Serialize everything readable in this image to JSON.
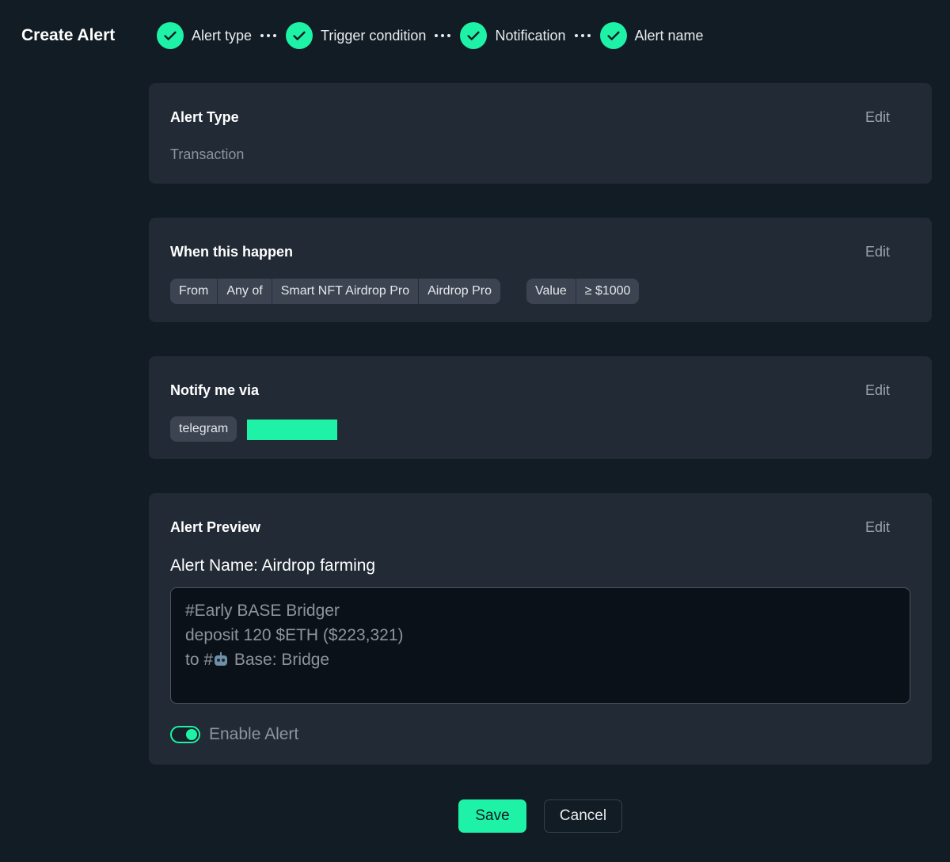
{
  "header": {
    "title": "Create Alert",
    "steps": [
      {
        "label": "Alert type",
        "icon": "check-circle-icon"
      },
      {
        "label": "Trigger condition",
        "icon": "check-circle-icon"
      },
      {
        "label": "Notification",
        "icon": "check-circle-icon"
      },
      {
        "label": "Alert name",
        "icon": "check-circle-icon"
      }
    ]
  },
  "alert_type": {
    "title": "Alert Type",
    "edit_label": "Edit",
    "value": "Transaction"
  },
  "condition": {
    "title": "When this happen",
    "edit_label": "Edit",
    "source_chips": [
      "From",
      "Any of",
      "Smart NFT Airdrop Pro",
      "Airdrop Pro"
    ],
    "value_chips": [
      "Value",
      "≥ $1000"
    ]
  },
  "notify": {
    "title": "Notify me via",
    "edit_label": "Edit",
    "channel": "telegram"
  },
  "preview": {
    "title": "Alert Preview",
    "edit_label": "Edit",
    "alert_name": "Alert Name: Airdrop farming",
    "message_line_1": "#Early BASE Bridger",
    "message_line_2": "deposit 120 $ETH ($223,321)",
    "message_line_3_prefix": "to #",
    "message_line_3_suffix": " Base: Bridge",
    "enable_label": "Enable Alert",
    "enabled": true
  },
  "actions": {
    "save_label": "Save",
    "cancel_label": "Cancel"
  },
  "colors": {
    "accent": "#1ef2a6",
    "background": "#121c24",
    "card": "#212a35"
  }
}
